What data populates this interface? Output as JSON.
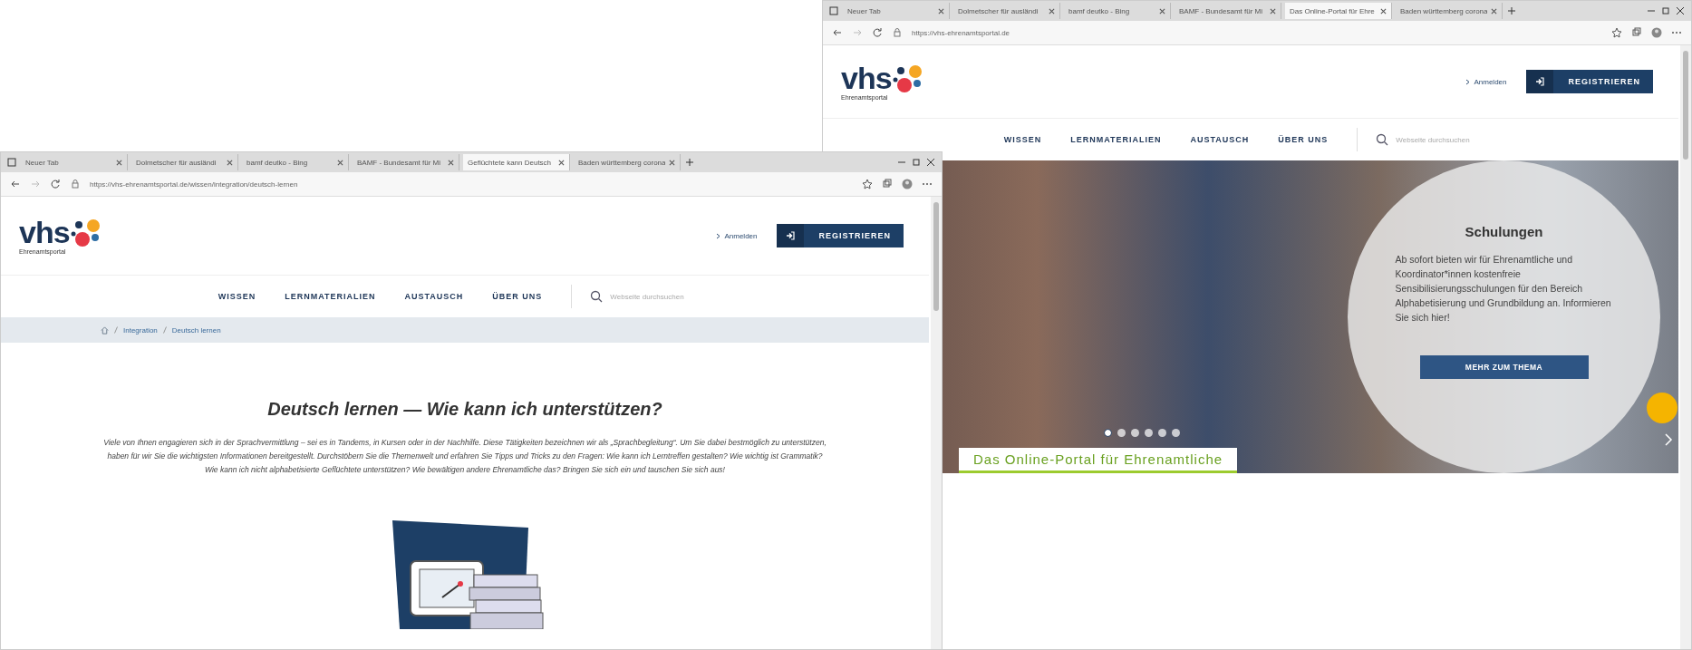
{
  "windows": [
    {
      "tabs": [
        {
          "label": "Neuer Tab",
          "selected": false
        },
        {
          "label": "Dolmetscher für ausländi",
          "selected": false
        },
        {
          "label": "bamf deutko - Bing",
          "selected": false
        },
        {
          "label": "BAMF - Bundesamt für Mi",
          "selected": false
        },
        {
          "label": "Das Online-Portal für Ehre",
          "selected": true
        },
        {
          "label": "Baden württemberg corona",
          "selected": false
        }
      ],
      "url": "https://vhs-ehrenamtsportal.de",
      "logo": {
        "text": "vhs",
        "subtitle": "Ehrenamtsportal"
      },
      "login": "Anmelden",
      "register": "REGISTRIEREN",
      "nav": [
        "WISSEN",
        "LERNMATERIALIEN",
        "AUSTAUSCH",
        "ÜBER UNS"
      ],
      "search": {
        "placeholder": "Webseite durchsuchen"
      },
      "hero": {
        "title": "Schulungen",
        "text": "Ab sofort bieten wir für Ehrenamtliche und Koordinator*innen kostenfreie Sensibilisierungsschulungen für den Bereich Alphabetisierung und Grundbildung an. Informieren Sie sich hier!",
        "button": "MEHR ZUM THEMA",
        "slides": [
          {
            "selected": true
          },
          {
            "selected": false
          },
          {
            "selected": false
          },
          {
            "selected": false
          },
          {
            "selected": false
          },
          {
            "selected": false
          }
        ],
        "caption": "Das Online-Portal für Ehrenamtliche"
      }
    },
    {
      "tabs": [
        {
          "label": "Neuer Tab",
          "selected": false
        },
        {
          "label": "Dolmetscher für ausländi",
          "selected": false
        },
        {
          "label": "bamf deutko - Bing",
          "selected": false
        },
        {
          "label": "BAMF - Bundesamt für Mi",
          "selected": false
        },
        {
          "label": "Geflüchtete kann Deutsch",
          "selected": true
        },
        {
          "label": "Baden württemberg corona",
          "selected": false
        }
      ],
      "url": "https://vhs-ehrenamtsportal.de/wissen/integration/deutsch-lernen",
      "logo": {
        "text": "vhs",
        "subtitle": "Ehrenamtsportal"
      },
      "login": "Anmelden",
      "register": "REGISTRIEREN",
      "nav": [
        "WISSEN",
        "LERNMATERIALIEN",
        "AUSTAUSCH",
        "ÜBER UNS"
      ],
      "search": {
        "placeholder": "Webseite durchsuchen"
      },
      "breadcrumb": [
        "Integration",
        "Deutsch lernen"
      ],
      "heading": "Deutsch lernen — Wie kann ich unterstützen?",
      "intro": "Viele von Ihnen engagieren sich in der Sprachvermittlung – sei es in Tandems, in Kursen oder in der Nachhilfe. Diese Tätigkeiten bezeichnen wir als „Sprachbegleitung“. Um Sie dabei bestmöglich zu unterstützen, haben für wir Sie die wichtigsten Informationen bereitgestellt. Durchstöbern Sie die Themenwelt und erfahren Sie Tipps und Tricks zu den Fragen: Wie kann ich Lerntreffen gestalten? Wie wichtig ist Grammatik? Wie kann ich nicht alphabetisierte Geflüchtete unterstützen? Wie bewältigen andere Ehrenamtliche das? Bringen Sie sich ein und tauschen Sie sich aus!"
    }
  ]
}
